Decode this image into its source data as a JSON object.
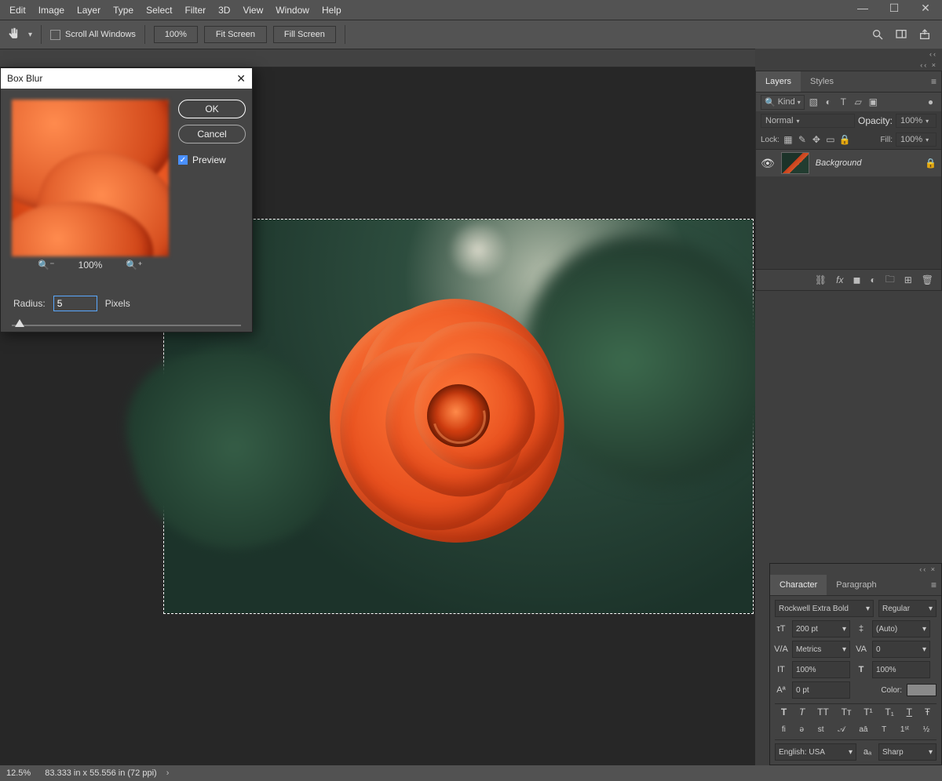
{
  "menu": [
    "Edit",
    "Image",
    "Layer",
    "Type",
    "Select",
    "Filter",
    "3D",
    "View",
    "Window",
    "Help"
  ],
  "options": {
    "scroll_all": "Scroll All Windows",
    "zoom": "100%",
    "fit": "Fit Screen",
    "fill": "Fill Screen"
  },
  "dialog": {
    "title": "Box Blur",
    "ok": "OK",
    "cancel": "Cancel",
    "preview": "Preview",
    "zoom": "100%",
    "radius_label": "Radius:",
    "radius_value": "5",
    "radius_unit": "Pixels"
  },
  "layers": {
    "tabs": [
      "Layers",
      "Styles"
    ],
    "filter": "Kind",
    "blend": "Normal",
    "opacity_label": "Opacity:",
    "opacity": "100%",
    "lock_label": "Lock:",
    "fill_label": "Fill:",
    "fill": "100%",
    "layer_name": "Background"
  },
  "character": {
    "tabs": [
      "Character",
      "Paragraph"
    ],
    "font": "Rockwell Extra Bold",
    "style": "Regular",
    "size": "200 pt",
    "leading": "(Auto)",
    "kerning": "Metrics",
    "tracking": "0",
    "scalev": "100%",
    "scaleh": "100%",
    "baseline": "0 pt",
    "color_label": "Color:",
    "lang": "English: USA",
    "aa": "Sharp"
  },
  "status": {
    "zoom": "12.5%",
    "doc": "83.333 in x 55.556 in (72 ppi)"
  }
}
